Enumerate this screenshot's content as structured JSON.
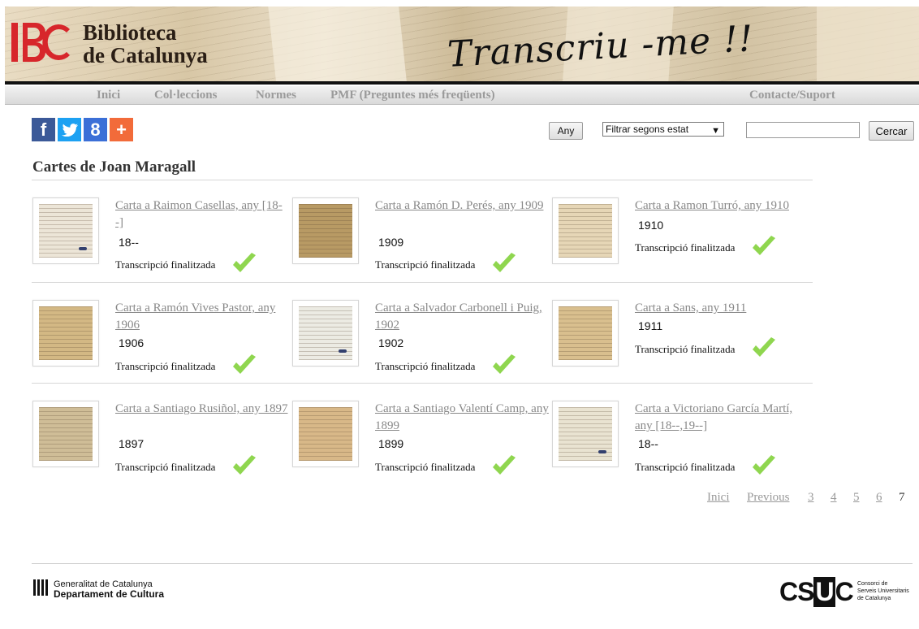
{
  "banner": {
    "logo_line1": "Biblioteca",
    "logo_line2": "de Catalunya",
    "title": "Transcriu -me !!",
    "brand_red": "#d7262b"
  },
  "nav": {
    "items": [
      "Inici",
      "Col·leccions",
      "Normes",
      "PMF (Preguntes més freqüents)"
    ],
    "contact": "Contacte/Suport"
  },
  "social": [
    "f",
    "t",
    "8",
    "+"
  ],
  "filters": {
    "any_button": "Any",
    "state_select": "Filtrar segons estat",
    "search_button": "Cercar",
    "search_value": ""
  },
  "page": {
    "heading": "Cartes de Joan Maragall"
  },
  "letters": [
    {
      "title": "Carta a Raimon Casellas, any [18--]",
      "year": "18--",
      "status": "Transcripció finalitzada"
    },
    {
      "title": "Carta a Ramón D. Perés, any 1909",
      "year": "1909",
      "status": "Transcripció finalitzada"
    },
    {
      "title": "Carta a Ramon Turró, any 1910",
      "year": "1910",
      "status": "Transcripció finalitzada"
    },
    {
      "title": "Carta a Ramón Vives Pastor, any 1906",
      "year": "1906",
      "status": "Transcripció finalitzada"
    },
    {
      "title": "Carta a Salvador Carbonell i Puig, 1902",
      "year": "1902",
      "status": "Transcripció finalitzada"
    },
    {
      "title": "Carta a Sans, any 1911",
      "year": "1911",
      "status": "Transcripció finalitzada"
    },
    {
      "title": "Carta a Santiago Rusiñol, any 1897",
      "year": "1897",
      "status": "Transcripció finalitzada"
    },
    {
      "title": "Carta a Santiago Valentí Camp, any 1899",
      "year": "1899",
      "status": "Transcripció finalitzada"
    },
    {
      "title": "Carta a Victoriano García Martí, any [18--,19--]",
      "year": "18--",
      "status": "Transcripció finalitzada"
    }
  ],
  "pagination": {
    "first": "Inici",
    "previous": "Previous",
    "pages": [
      "3",
      "4",
      "5",
      "6"
    ],
    "current": "7"
  },
  "footer": {
    "gen_line1": "Generalitat de Catalunya",
    "gen_line2": "Departament de Cultura",
    "csuc_c": "CS",
    "csuc_u": "U",
    "csuc_end": "C",
    "csuc_sub1": "Consorci de",
    "csuc_sub2": "Serveis Universitaris",
    "csuc_sub3": "de Catalunya"
  }
}
